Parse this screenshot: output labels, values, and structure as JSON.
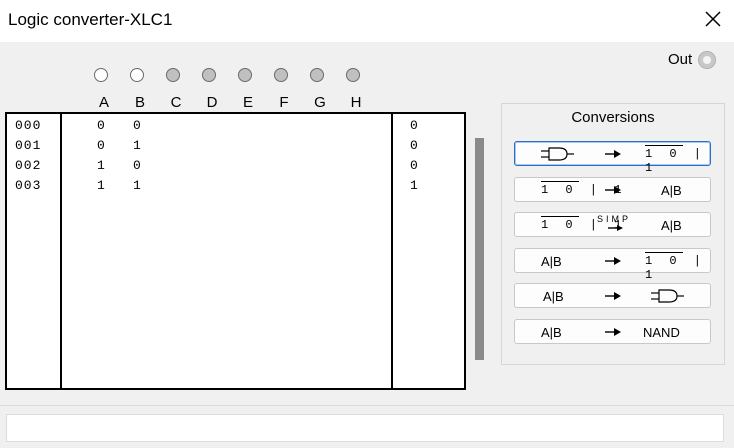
{
  "window": {
    "title": "Logic converter-XLC1",
    "close_icon": "close-icon"
  },
  "output": {
    "label": "Out"
  },
  "inputs": [
    {
      "label": "A",
      "state": "on"
    },
    {
      "label": "B",
      "state": "on"
    },
    {
      "label": "C",
      "state": "off"
    },
    {
      "label": "D",
      "state": "off"
    },
    {
      "label": "E",
      "state": "off"
    },
    {
      "label": "F",
      "state": "off"
    },
    {
      "label": "G",
      "state": "off"
    },
    {
      "label": "H",
      "state": "off"
    }
  ],
  "truth_table": {
    "rows": [
      {
        "index": "000",
        "a": "0",
        "b": "0",
        "out": "0"
      },
      {
        "index": "001",
        "a": "0",
        "b": "1",
        "out": "0"
      },
      {
        "index": "002",
        "a": "1",
        "b": "0",
        "out": "0"
      },
      {
        "index": "003",
        "a": "1",
        "b": "1",
        "out": "1"
      }
    ]
  },
  "conversions": {
    "title": "Conversions",
    "truth_table_glyph": "1 0 | 1",
    "expression_glyph": "A|B",
    "simp_label": "SIMP",
    "nand_label": "NAND"
  },
  "status": {
    "text": ""
  }
}
